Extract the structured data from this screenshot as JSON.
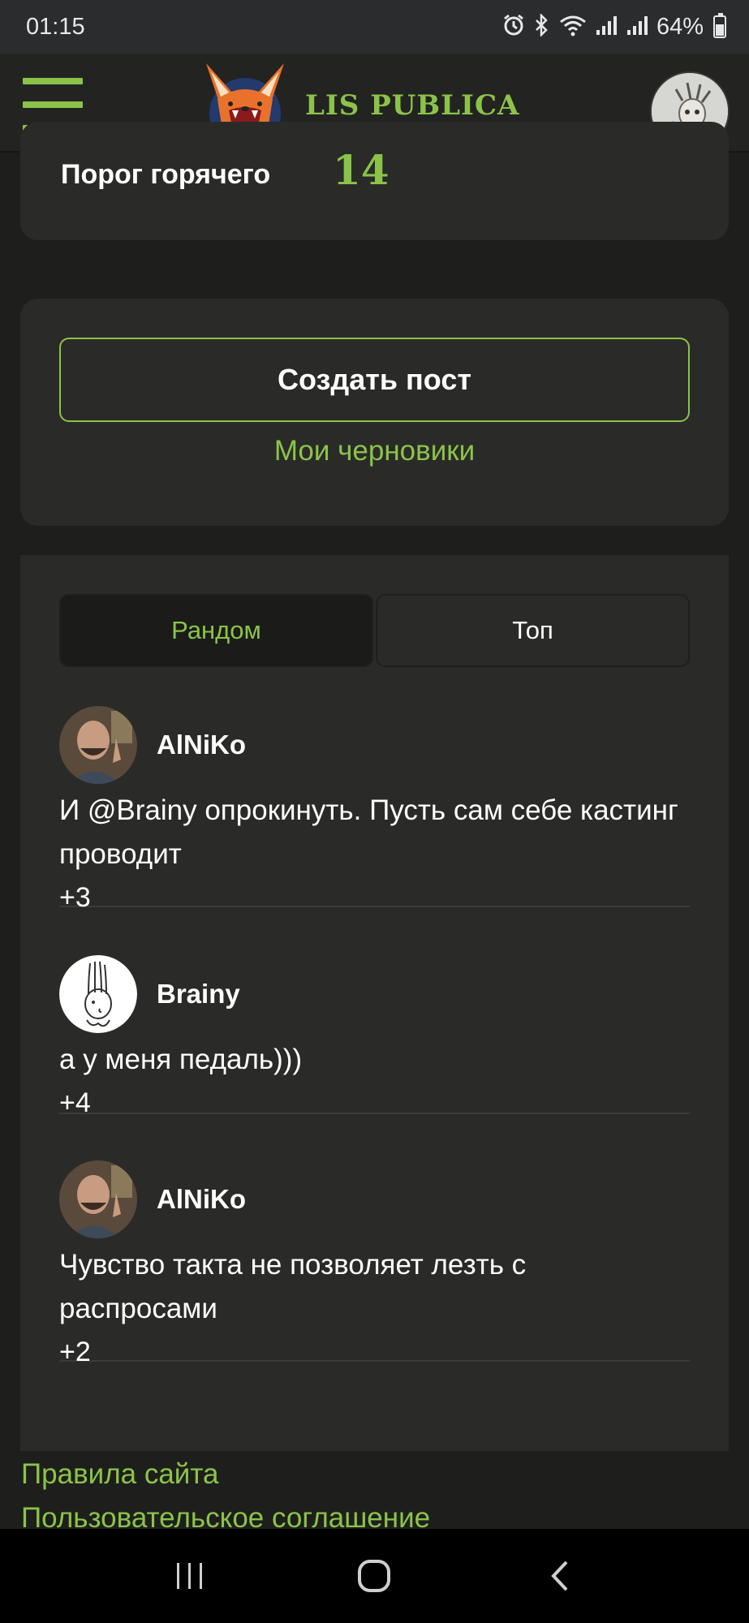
{
  "status_bar": {
    "time": "01:15",
    "battery": "64%",
    "battery_level": 0.64,
    "icons": [
      "alarm-icon",
      "bluetooth-icon",
      "wifi-icon",
      "signal-icon",
      "signal-icon",
      "battery-icon"
    ]
  },
  "header": {
    "logo_text": "LIS PUBLICA",
    "menu_icon": "hamburger-menu-icon",
    "accent_color": "#8bc34a"
  },
  "threshold": {
    "label": "Порог горячего",
    "value": "14"
  },
  "create": {
    "button_label": "Создать пост",
    "drafts_label": "Мои черновики"
  },
  "feed": {
    "tabs": [
      {
        "label": "Рандом",
        "active": true
      },
      {
        "label": "Топ",
        "active": false
      }
    ],
    "comments": [
      {
        "author": "AlNiKo",
        "text": "И @Brainy опрокинуть. Пусть сам себе кастинг проводит",
        "score": "+3"
      },
      {
        "author": "Brainy",
        "text": "а у меня педаль)))",
        "score": "+4"
      },
      {
        "author": "AlNiKo",
        "text": "Чувство такта не позволяет лезть с распросами",
        "score": "+2"
      }
    ]
  },
  "footer": {
    "links": [
      "Правила сайта",
      "Пользовательское соглашение"
    ]
  },
  "nav_bar": {
    "icons": [
      "recent-apps-icon",
      "home-icon",
      "back-icon"
    ]
  }
}
